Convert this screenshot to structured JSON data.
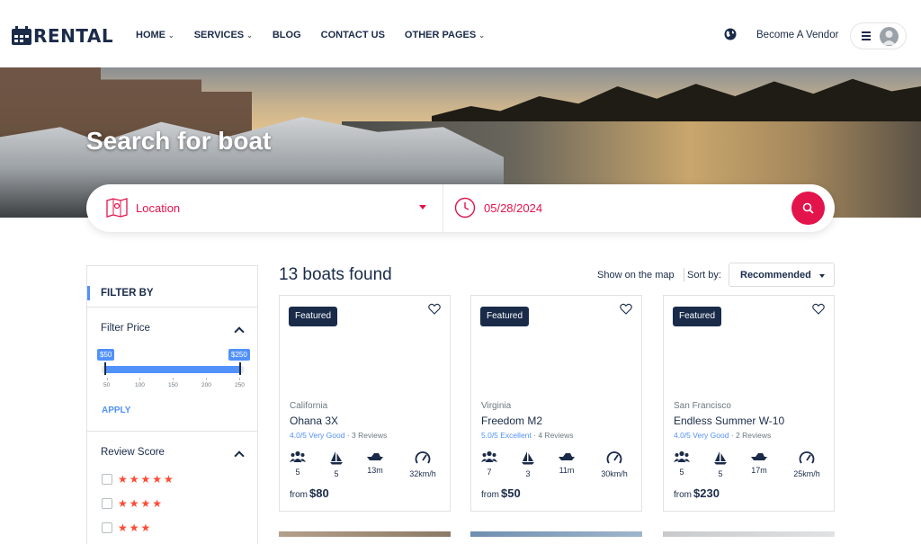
{
  "header": {
    "logo_text": "RENTAL",
    "nav": [
      {
        "label": "HOME",
        "has_dropdown": true
      },
      {
        "label": "SERVICES",
        "has_dropdown": true
      },
      {
        "label": "BLOG",
        "has_dropdown": false
      },
      {
        "label": "CONTACT US",
        "has_dropdown": false
      },
      {
        "label": "OTHER PAGES",
        "has_dropdown": true
      }
    ],
    "chevron": "⌄",
    "vendor_link": "Become A Vendor",
    "icons": {
      "globe": "globe-icon",
      "menu": "hamburger-icon",
      "avatar": "user-avatar-icon"
    }
  },
  "hero": {
    "title": "Search for boat"
  },
  "search": {
    "location_placeholder": "Location",
    "date_value": "05/28/2024",
    "accent": "#e3134c"
  },
  "sidebar": {
    "title": "FILTER BY",
    "price": {
      "heading": "Filter Price",
      "min_label": "$50",
      "max_label": "$250",
      "selected_min": 50,
      "selected_max": 250,
      "ticks": [
        "50",
        "100",
        "150",
        "200",
        "250"
      ],
      "apply_label": "APPLY"
    },
    "review": {
      "heading": "Review Score",
      "options": [
        {
          "stars": "★★★★★",
          "checked": false
        },
        {
          "stars": "★★★★",
          "checked": false
        },
        {
          "stars": "★★★",
          "checked": false
        }
      ]
    }
  },
  "results": {
    "count_text": "13 boats found",
    "show_map": "Show on the map",
    "sort_label": "Sort by:",
    "sort_value": "Recommended"
  },
  "cards": [
    {
      "badge": "Featured",
      "location": "California",
      "name": "Ohana 3X",
      "rating": "4.0/5 Very Good",
      "reviews": "3 Reviews",
      "passengers": "5",
      "cabins": "5",
      "length": "13m",
      "speed": "32km/h",
      "from": "from",
      "price": "$80"
    },
    {
      "badge": "Featured",
      "location": "Virginia",
      "name": "Freedom M2",
      "rating": "5.0/5 Excellent",
      "reviews": "4 Reviews",
      "passengers": "7",
      "cabins": "3",
      "length": "11m",
      "speed": "30km/h",
      "from": "from",
      "price": "$50"
    },
    {
      "badge": "Featured",
      "location": "San Francisco",
      "name": "Endless Summer W-10",
      "rating": "4.0/5 Very Good",
      "reviews": "2 Reviews",
      "passengers": "5",
      "cabins": "5",
      "length": "17m",
      "speed": "25km/h",
      "from": "from",
      "price": "$230"
    }
  ],
  "colors": {
    "primary": "#1a2b49",
    "accent": "#e3134c",
    "link": "#5191fa",
    "star": "#ff4a33"
  }
}
